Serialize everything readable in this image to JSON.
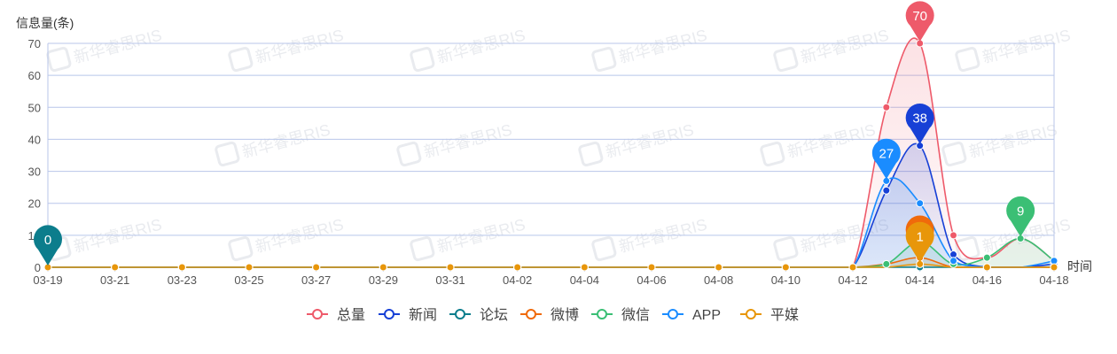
{
  "chart_data": {
    "type": "line",
    "ylabel": "信息量(条)",
    "xlabel": "时间",
    "ylim": [
      0,
      70
    ],
    "yticks": [
      0,
      10,
      20,
      30,
      40,
      50,
      60,
      70
    ],
    "dates": [
      "03-19",
      "03-20",
      "03-21",
      "03-22",
      "03-23",
      "03-24",
      "03-25",
      "03-26",
      "03-27",
      "03-28",
      "03-29",
      "03-30",
      "03-31",
      "04-01",
      "04-02",
      "04-03",
      "04-04",
      "04-05",
      "04-06",
      "04-07",
      "04-08",
      "04-09",
      "04-10",
      "04-11",
      "04-12",
      "04-13",
      "04-14",
      "04-15",
      "04-16",
      "04-17",
      "04-18"
    ],
    "x_tick_labels": [
      "03-19",
      "03-21",
      "03-23",
      "03-25",
      "03-27",
      "03-29",
      "03-31",
      "04-02",
      "04-04",
      "04-06",
      "04-08",
      "04-10",
      "04-12",
      "04-14",
      "04-16",
      "04-18"
    ],
    "grid": true,
    "legend_position": "bottom",
    "series": [
      {
        "name": "总量",
        "color": "#ee5a6a",
        "values": [
          0,
          0,
          0,
          0,
          0,
          0,
          0,
          0,
          0,
          0,
          0,
          0,
          0,
          0,
          0,
          0,
          0,
          0,
          0,
          0,
          0,
          0,
          0,
          0,
          0,
          50,
          70,
          10,
          3,
          9,
          2
        ],
        "area": true
      },
      {
        "name": "新闻",
        "color": "#1740d6",
        "values": [
          0,
          0,
          0,
          0,
          0,
          0,
          0,
          0,
          0,
          0,
          0,
          0,
          0,
          0,
          0,
          0,
          0,
          0,
          0,
          0,
          0,
          0,
          0,
          0,
          0,
          24,
          38,
          4,
          0,
          0,
          1
        ],
        "area": true
      },
      {
        "name": "论坛",
        "color": "#0c7d8c",
        "values": [
          0,
          0,
          0,
          0,
          0,
          0,
          0,
          0,
          0,
          0,
          0,
          0,
          0,
          0,
          0,
          0,
          0,
          0,
          0,
          0,
          0,
          0,
          0,
          0,
          0,
          0,
          0,
          0,
          0,
          0,
          0
        ]
      },
      {
        "name": "微博",
        "color": "#f06a0b",
        "values": [
          0,
          0,
          0,
          0,
          0,
          0,
          0,
          0,
          0,
          0,
          0,
          0,
          0,
          0,
          0,
          0,
          0,
          0,
          0,
          0,
          0,
          0,
          0,
          0,
          0,
          1,
          3,
          0,
          0,
          0,
          0
        ]
      },
      {
        "name": "微信",
        "color": "#3bbf75",
        "values": [
          0,
          0,
          0,
          0,
          0,
          0,
          0,
          0,
          0,
          0,
          0,
          0,
          0,
          0,
          0,
          0,
          0,
          0,
          0,
          0,
          0,
          0,
          0,
          0,
          0,
          1,
          8,
          1,
          3,
          9,
          2
        ]
      },
      {
        "name": "APP",
        "color": "#1a8cff",
        "values": [
          0,
          0,
          0,
          0,
          0,
          0,
          0,
          0,
          0,
          0,
          0,
          0,
          0,
          0,
          0,
          0,
          0,
          0,
          0,
          0,
          0,
          0,
          0,
          0,
          0,
          27,
          20,
          2,
          0,
          0,
          2
        ]
      },
      {
        "name": "平媒",
        "color": "#e8960a",
        "values": [
          0,
          0,
          0,
          0,
          0,
          0,
          0,
          0,
          0,
          0,
          0,
          0,
          0,
          0,
          0,
          0,
          0,
          0,
          0,
          0,
          0,
          0,
          0,
          0,
          0,
          0,
          1,
          0,
          0,
          0,
          0
        ]
      }
    ],
    "annotations": [
      {
        "series": "总量",
        "date": "04-14",
        "value": 70,
        "label": "70"
      },
      {
        "series": "新闻",
        "date": "04-14",
        "value": 38,
        "label": "38"
      },
      {
        "series": "APP",
        "date": "04-13",
        "value": 27,
        "label": "27"
      },
      {
        "series": "微信",
        "date": "04-17",
        "value": 9,
        "label": "9"
      },
      {
        "series": "微博",
        "date": "04-14",
        "value": 3,
        "label": ""
      },
      {
        "series": "平媒",
        "date": "04-14",
        "value": 1,
        "label": "1"
      },
      {
        "series": "论坛",
        "date": "03-19",
        "value": 0,
        "label": "0"
      }
    ],
    "watermark": "新华睿思RIS"
  }
}
